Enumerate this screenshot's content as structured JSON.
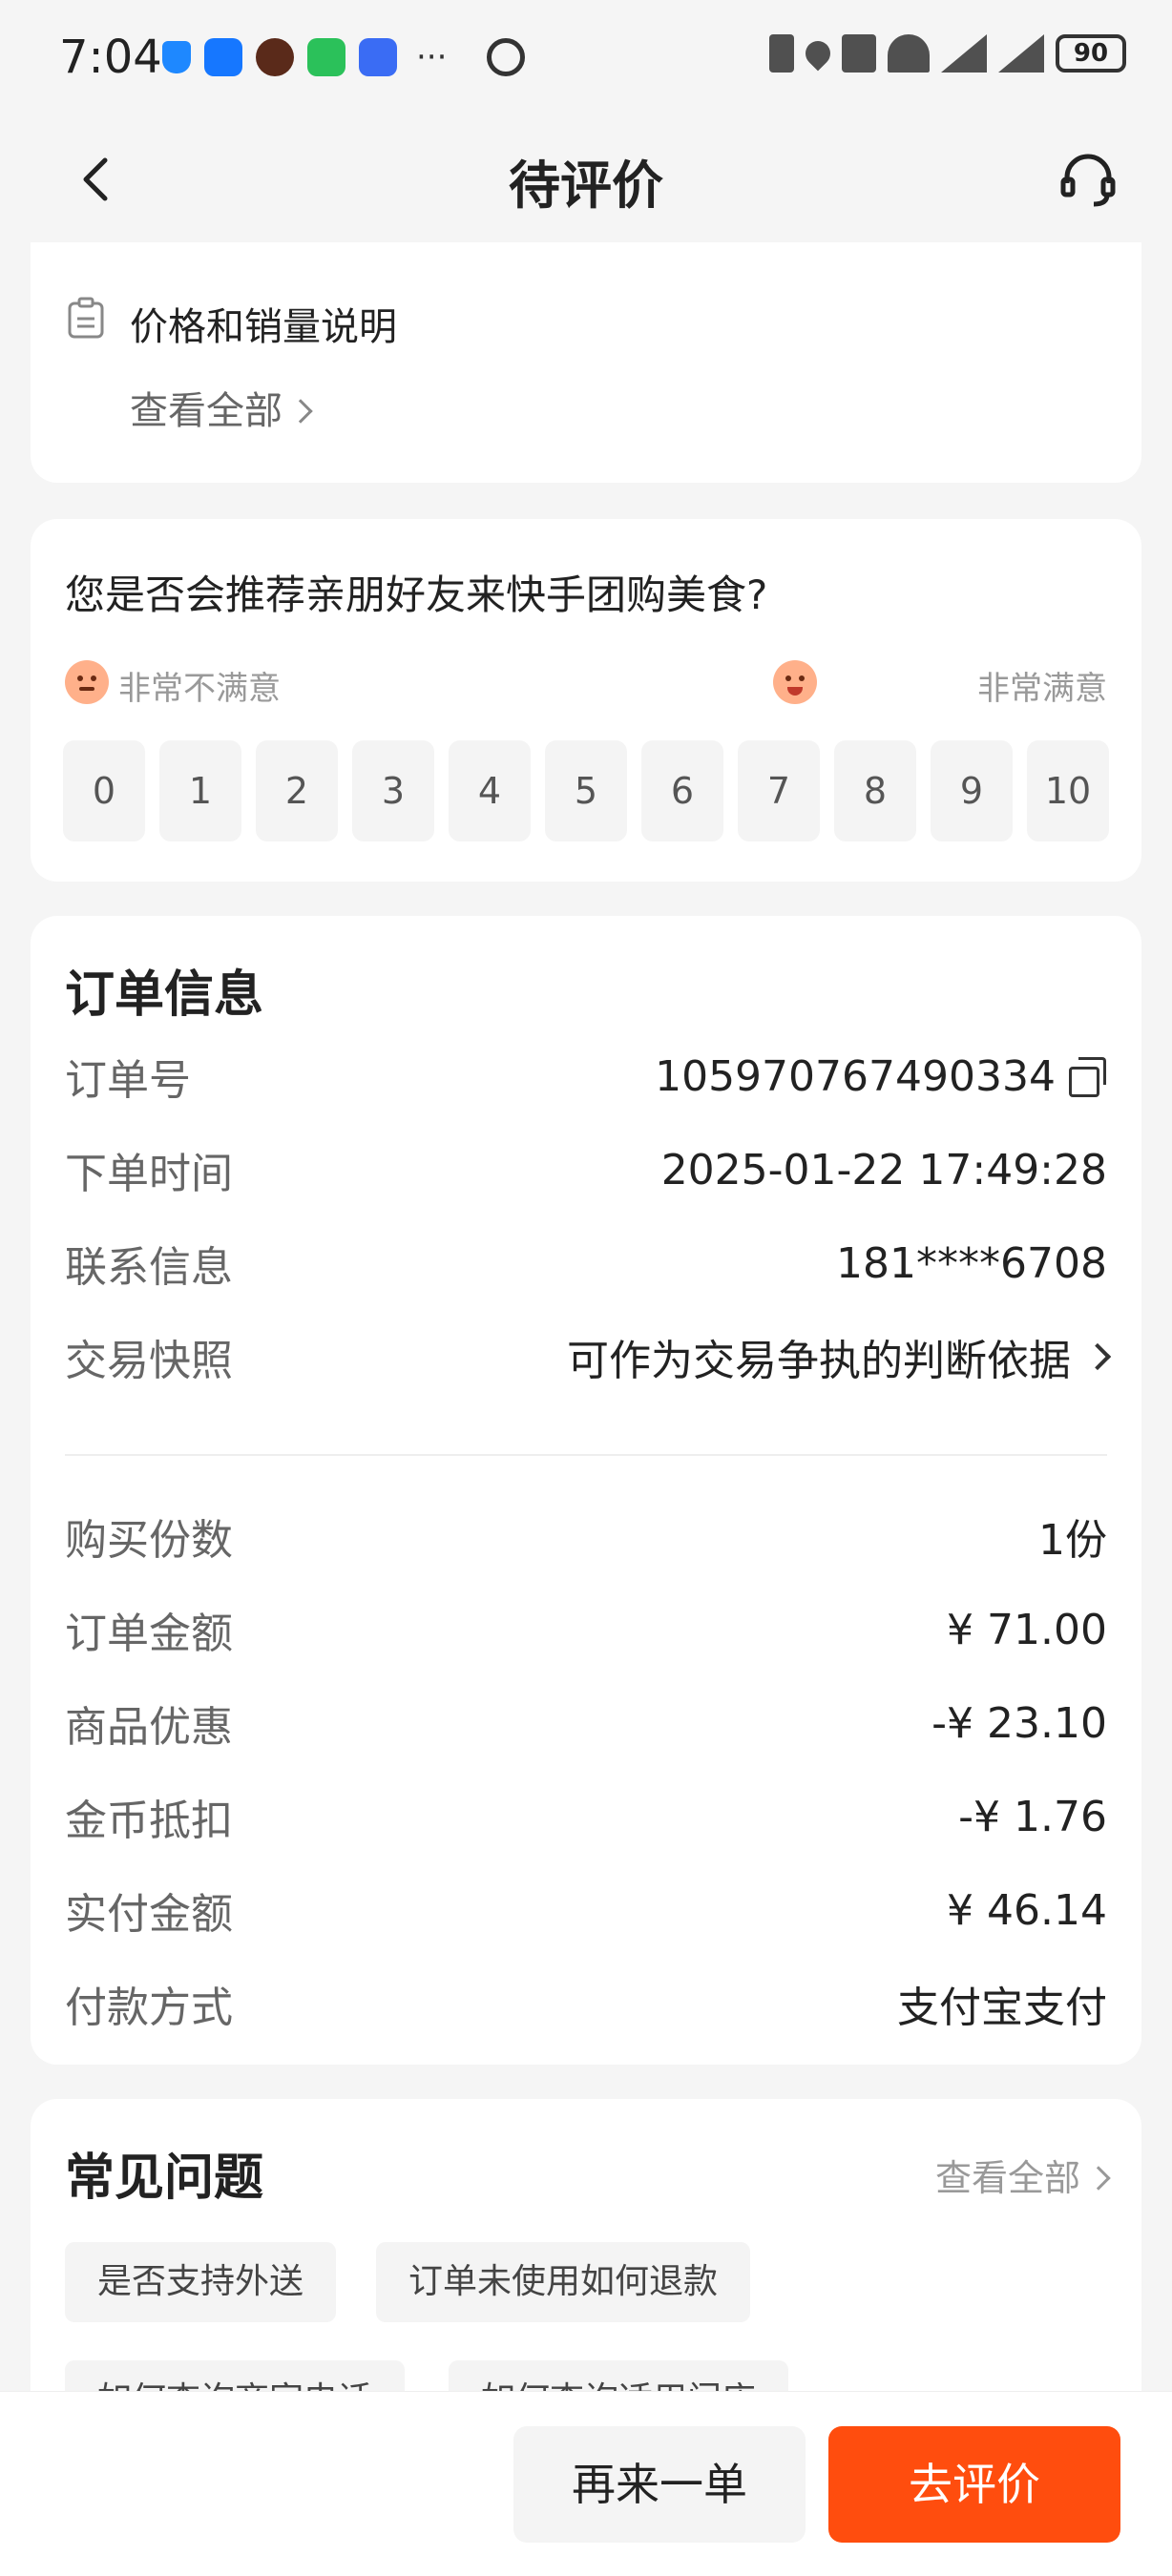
{
  "status_bar": {
    "time": "7:04",
    "battery": "90"
  },
  "nav": {
    "title": "待评价"
  },
  "price_notice": {
    "title": "价格和销量说明",
    "link": "查看全部"
  },
  "survey": {
    "question": "您是否会推荐亲朋好友来快手团购美食?",
    "low_label": "非常不满意",
    "high_label": "非常满意",
    "scale": [
      "0",
      "1",
      "2",
      "3",
      "4",
      "5",
      "6",
      "7",
      "8",
      "9",
      "10"
    ]
  },
  "order": {
    "title": "订单信息",
    "rows": [
      {
        "label": "订单号",
        "value": "105970767490334"
      },
      {
        "label": "下单时间",
        "value": "2025-01-22 17:49:28"
      },
      {
        "label": "联系信息",
        "value": "181****6708"
      },
      {
        "label": "交易快照",
        "value": "可作为交易争执的判断依据"
      },
      {
        "label": "购买份数",
        "value": "1份"
      },
      {
        "label": "订单金额",
        "value": "¥ 71.00"
      },
      {
        "label": "商品优惠",
        "value": "-¥ 23.10"
      },
      {
        "label": "金币抵扣",
        "value": "-¥ 1.76"
      },
      {
        "label": "实付金额",
        "value": "¥ 46.14"
      },
      {
        "label": "付款方式",
        "value": "支付宝支付"
      }
    ]
  },
  "faq": {
    "title": "常见问题",
    "view_all": "查看全部",
    "chips": [
      "是否支持外送",
      "订单未使用如何退款",
      "如何查询商家电话",
      "如何查询适用门店"
    ]
  },
  "actions": {
    "again": "再来一单",
    "review": "去评价"
  },
  "colors": {
    "accent": "#ff4d0e",
    "background": "#f5f5f5"
  }
}
